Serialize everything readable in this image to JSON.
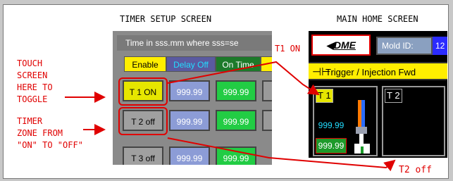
{
  "left_title": "TIMER SETUP SCREEN",
  "right_title": "MAIN HOME SCREEN",
  "annotations": {
    "touch_lines": [
      "TOUCH",
      "SCREEN",
      "HERE TO",
      "TOGGLE"
    ],
    "timer_lines": [
      "TIMER",
      "ZONE FROM",
      "\"ON\" TO \"OFF\""
    ],
    "t1_on": "T1 ON",
    "t2_off": "T2 off"
  },
  "setup": {
    "header": "Time in sss.mm where sss=se",
    "columns": [
      "Enable",
      "Delay Off",
      "On Time"
    ],
    "rows": [
      {
        "enable": "T 1 ON",
        "delay": "999.99",
        "ontime": "999.99"
      },
      {
        "enable": "T 2 off",
        "delay": "999.99",
        "ontime": "999.99"
      },
      {
        "enable": "T 3 off",
        "delay": "999.99",
        "ontime": "999.99"
      }
    ]
  },
  "home": {
    "brand": "DME",
    "mold_label": "Mold ID:",
    "mold_value": "12",
    "trigger": "Trigger / Injection Fwd",
    "zone1": {
      "label": "T 1",
      "top": "999.99",
      "bottom": "999.99"
    },
    "zone2": {
      "label": "T 2"
    }
  },
  "colors": {
    "red": "#e00000",
    "on_yellow": "#e6e600",
    "green": "#22cc44",
    "cyan": "#22ddff",
    "trigger": "#ffee00"
  }
}
